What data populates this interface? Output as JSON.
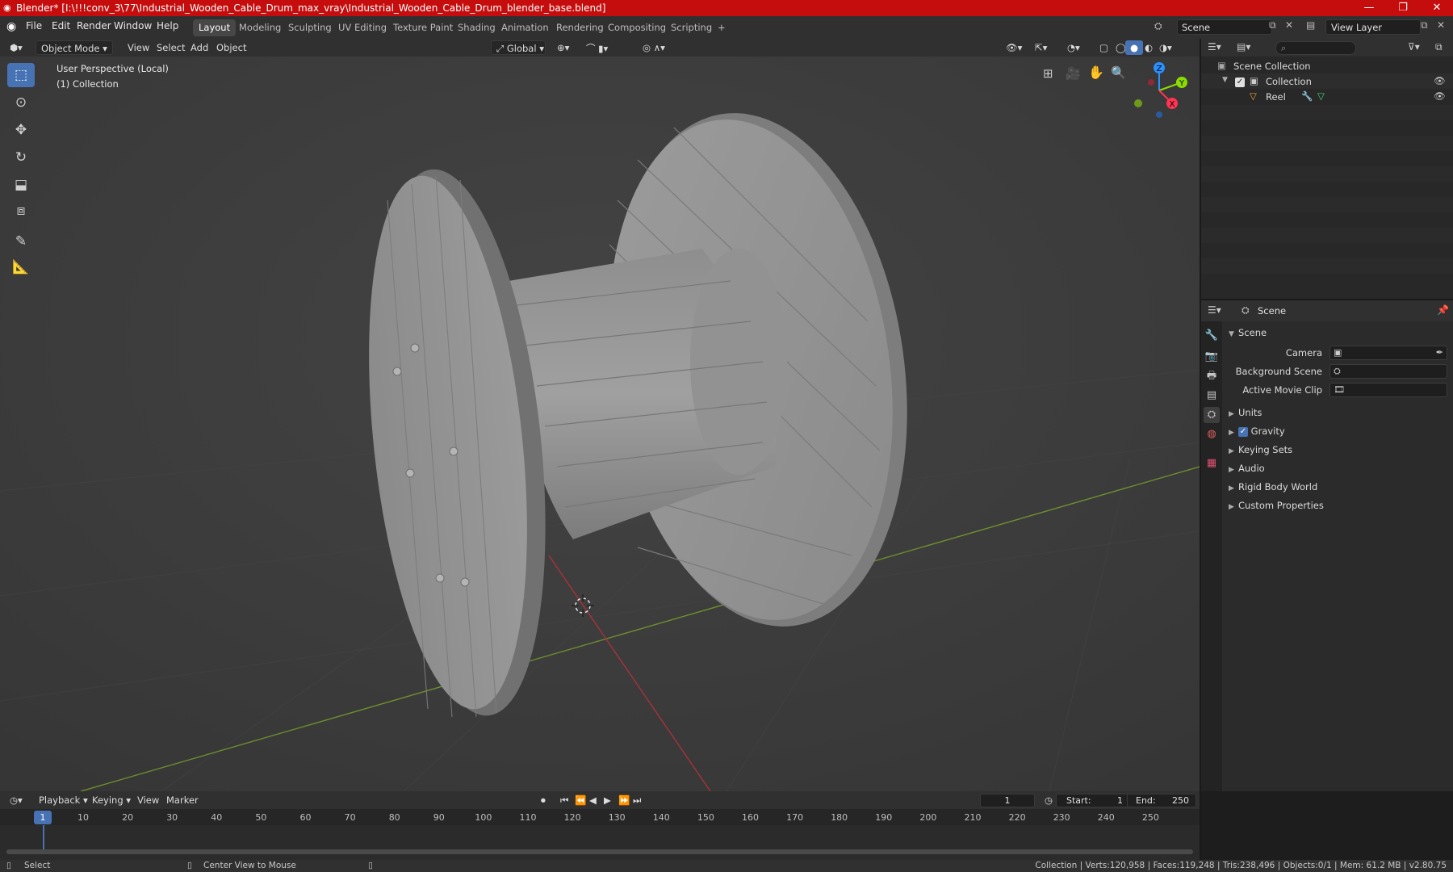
{
  "titlebar": {
    "title": "Blender* [I:\\!!!conv_3\\77\\Industrial_Wooden_Cable_Drum_max_vray\\Industrial_Wooden_Cable_Drum_blender_base.blend]",
    "minimize": "—",
    "maximize": "❐",
    "close": "✕",
    "bg_color": "#c50d0d"
  },
  "menu": {
    "items": [
      "File",
      "Edit",
      "Render",
      "Window",
      "Help"
    ]
  },
  "workspaces": {
    "tabs": [
      "Layout",
      "Modeling",
      "Sculpting",
      "UV Editing",
      "Texture Paint",
      "Shading",
      "Animation",
      "Rendering",
      "Compositing",
      "Scripting"
    ],
    "active": "Layout",
    "add": "+"
  },
  "scene_selector": {
    "label": "Scene"
  },
  "viewlayer_selector": {
    "label": "View Layer"
  },
  "viewport": {
    "mode": "Object Mode",
    "menus": [
      "View",
      "Select",
      "Add",
      "Object"
    ],
    "transform_orientation": "Global",
    "overlay_line1": "User Perspective (Local)",
    "overlay_line2": "(1) Collection",
    "gizmo_axes": {
      "x": "X",
      "y": "Y",
      "z": "Z"
    },
    "bg_color": "#3d3d3d"
  },
  "outliner": {
    "root": "Scene Collection",
    "collection": "Collection",
    "object": "Reel"
  },
  "properties": {
    "header": "Scene",
    "panel": "Scene",
    "fields": {
      "camera": "Camera",
      "background_scene": "Background Scene",
      "active_movie_clip": "Active Movie Clip"
    },
    "sections": [
      "Units",
      "Gravity",
      "Keying Sets",
      "Audio",
      "Rigid Body World",
      "Custom Properties"
    ],
    "gravity_checked": true
  },
  "timeline": {
    "menus": [
      "Playback",
      "Keying",
      "View",
      "Marker"
    ],
    "current_frame": "1",
    "start_label": "Start:",
    "start": "1",
    "end_label": "End:",
    "end": "250",
    "ticks": [
      "1",
      "10",
      "20",
      "30",
      "40",
      "50",
      "60",
      "70",
      "80",
      "90",
      "100",
      "110",
      "120",
      "130",
      "140",
      "150",
      "160",
      "170",
      "180",
      "190",
      "200",
      "210",
      "220",
      "230",
      "240",
      "250"
    ]
  },
  "statusbar": {
    "left1": "Select",
    "left2": "Center View to Mouse",
    "stats": "Collection | Verts:120,958 | Faces:119,248 | Tris:238,496 | Objects:0/1 | Mem: 61.2 MB | v2.80.75"
  },
  "colors": {
    "accent": "#4772b3",
    "axis_x": "#ff3352",
    "axis_y": "#8bdc00",
    "axis_z": "#2890ff"
  }
}
